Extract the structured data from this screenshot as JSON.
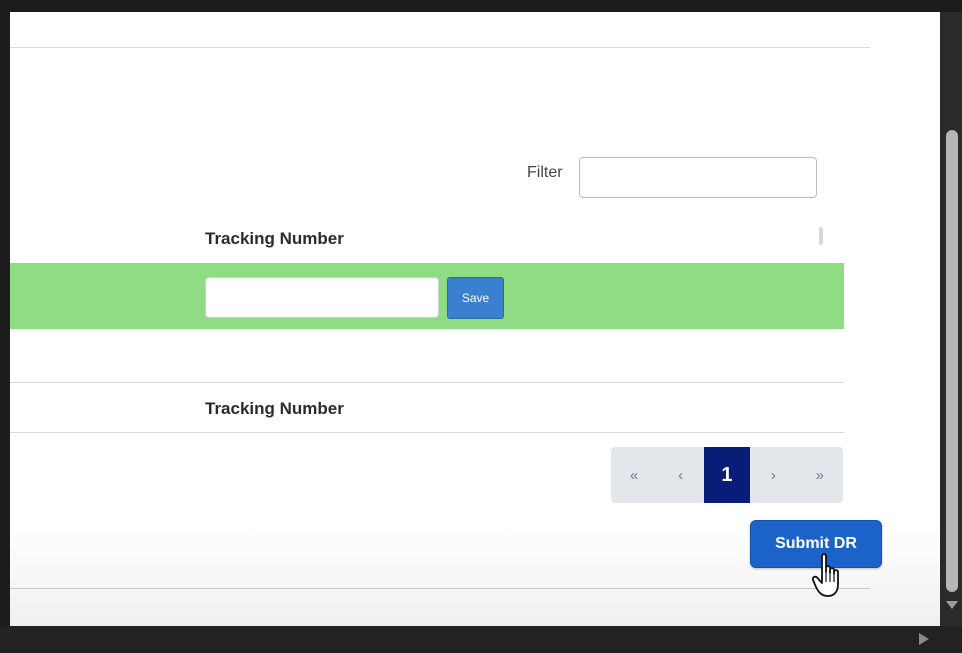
{
  "filter": {
    "label": "Filter",
    "value": "",
    "placeholder": ""
  },
  "table_top": {
    "header": "Tracking Number",
    "row_input_value": "",
    "save_label": "Save"
  },
  "table_bottom": {
    "header": "Tracking Number"
  },
  "pagination": {
    "first": "«",
    "prev": "‹",
    "current": "1",
    "next": "›",
    "last": "»"
  },
  "actions": {
    "submit_label": "Submit DR"
  },
  "colors": {
    "row_highlight": "#8fdc85",
    "primary_button": "#1c63c9",
    "active_page": "#071d78"
  },
  "icons": [
    "sort-icon",
    "hand-cursor-icon",
    "scroll-down-arrow-icon",
    "scroll-right-arrow-icon"
  ]
}
